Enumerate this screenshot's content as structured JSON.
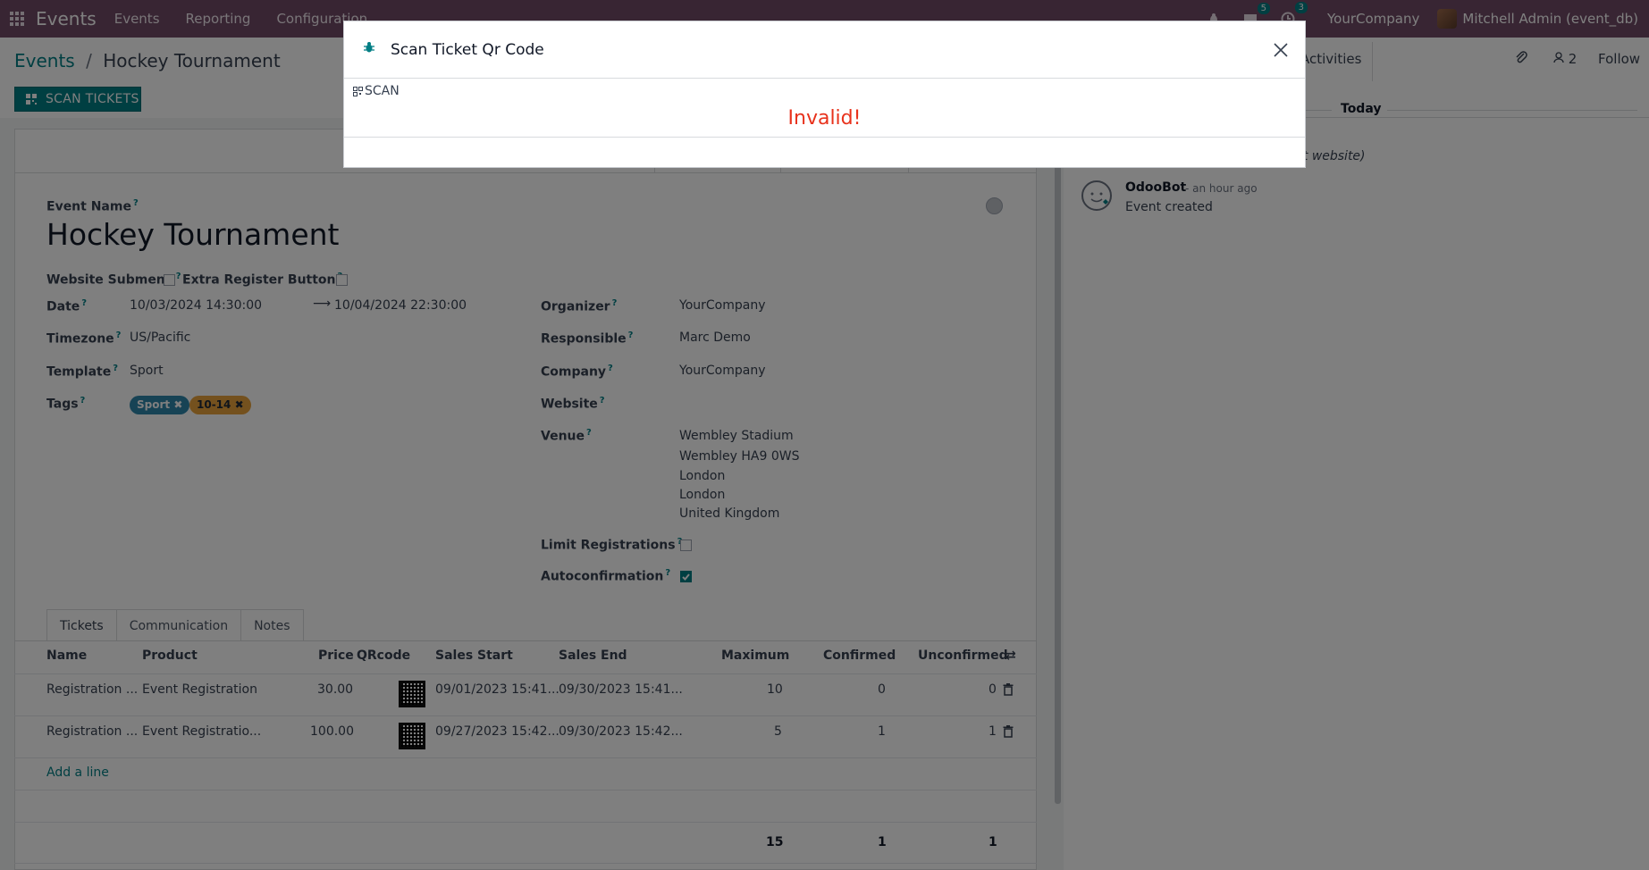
{
  "navbar": {
    "brand": "Events",
    "menu": [
      "Events",
      "Reporting",
      "Configuration"
    ],
    "chat_badge": "5",
    "activity_badge": "3",
    "company": "YourCompany",
    "user": "Mitchell Admin (event_db)"
  },
  "breadcrumb": {
    "parent": "Events",
    "sep": "/",
    "current": "Hockey Tournament"
  },
  "actions": {
    "scan_tickets": "SCAN TICKETS"
  },
  "chatter": {
    "activities": "Activities",
    "followers_count": "2",
    "follow": "Follow",
    "today": "Today",
    "partial_message": "nt website)",
    "messages": [
      {
        "author": "OdooBot",
        "time": "- an hour ago",
        "body": "Event created"
      }
    ]
  },
  "form": {
    "event_name_label": "Event Name",
    "event_name": "Hockey Tournament",
    "website_submenu_label": "Website Submenu",
    "extra_register_label": "Extra Register Button",
    "date_label": "Date",
    "date_start": "10/03/2024 14:30:00",
    "date_end": "10/04/2024 22:30:00",
    "timezone_label": "Timezone",
    "timezone": "US/Pacific",
    "template_label": "Template",
    "template": "Sport",
    "tags_label": "Tags",
    "tags": [
      "Sport",
      "10-14"
    ],
    "organizer_label": "Organizer",
    "organizer": "YourCompany",
    "responsible_label": "Responsible",
    "responsible": "Marc Demo",
    "company_label": "Company",
    "company": "YourCompany",
    "website_label": "Website",
    "venue_label": "Venue",
    "venue_lines": [
      "Wembley Stadium",
      "Wembley HA9 0WS",
      "London",
      "London",
      "United Kingdom"
    ],
    "limit_label": "Limit Registrations",
    "autoconfirm_label": "Autoconfirmation"
  },
  "tabs": [
    "Tickets",
    "Communication",
    "Notes"
  ],
  "tickets": {
    "headers": [
      "Name",
      "Product",
      "Price",
      "QRcode",
      "Sales Start",
      "Sales End",
      "Maximum",
      "Confirmed",
      "Unconfirmed"
    ],
    "rows": [
      {
        "name": "Registration ...",
        "product": "Event Registration",
        "price": "30.00",
        "start": "09/01/2023 15:41...",
        "end": "09/30/2023 15:41...",
        "max": "10",
        "confirmed": "0",
        "unconfirmed": "0"
      },
      {
        "name": "Registration ...",
        "product": "Event Registratio...",
        "price": "100.00",
        "start": "09/27/2023 15:42...",
        "end": "09/30/2023 15:42...",
        "max": "5",
        "confirmed": "1",
        "unconfirmed": "1"
      }
    ],
    "add_line": "Add a line",
    "totals": {
      "max": "15",
      "confirmed": "1",
      "unconfirmed": "1"
    }
  },
  "modal": {
    "title": "Scan Ticket Qr Code",
    "scan_label": "SCAN",
    "result": "Invalid!"
  },
  "colors": {
    "brand": "#714B67",
    "accent": "#017e84",
    "error": "#e8321c"
  }
}
